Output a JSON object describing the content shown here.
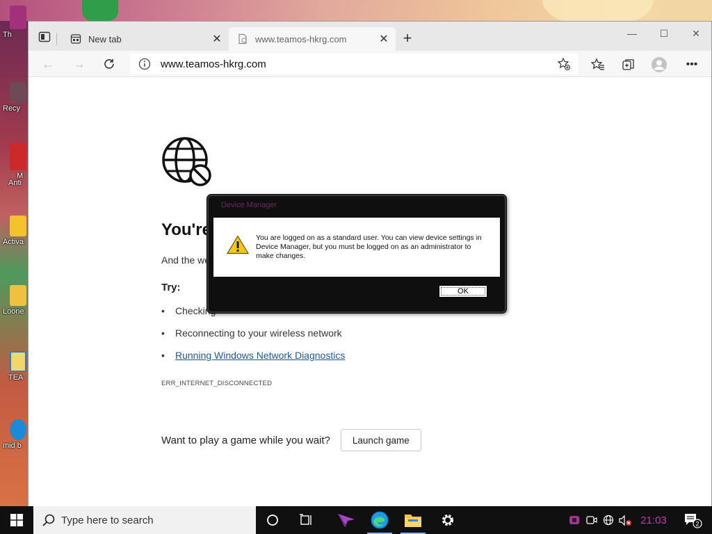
{
  "desktop": {
    "icons": [
      {
        "label": "Th",
        "color": "#a3307a"
      },
      {
        "label": "Recy",
        "color": "#6d6d6d"
      },
      {
        "label": "M",
        "color": "#cc2a2a"
      },
      {
        "label": "Anti",
        "color": "#cc2a2a"
      },
      {
        "label": "Activa",
        "color": "#f2c32d"
      },
      {
        "label": "Loone",
        "color": "#f0c040"
      },
      {
        "label": "TEA",
        "color": "#2b7bd6"
      },
      {
        "label": "mid b",
        "color": "#1e8ad6"
      }
    ]
  },
  "browser": {
    "tabs": [
      {
        "label": "New tab",
        "close": "✕"
      },
      {
        "label": "www.teamos-hkrg.com",
        "close": "✕"
      }
    ],
    "new_tab": "+",
    "window_controls": {
      "minimize": "—",
      "maximize": "☐",
      "close": "✕"
    },
    "toolbar": {
      "back": "←",
      "forward": "→",
      "url": "www.teamos-hkrg.com"
    },
    "page": {
      "heading": "You're",
      "subtext": "And the we",
      "try_label": "Try:",
      "tips": [
        {
          "bullet": "•",
          "text": "Checking"
        },
        {
          "bullet": "•",
          "text": "Reconnecting to your wireless network"
        },
        {
          "bullet": "•",
          "text": "Running Windows Network Diagnostics"
        }
      ],
      "error_code": "ERR_INTERNET_DISCONNECTED",
      "game_prompt": "Want to play a game while you wait?",
      "game_button": "Launch game"
    }
  },
  "dialog": {
    "title": "Device Manager",
    "message": "You are logged on as a standard user. You can view device settings in Device Manager, but you must be logged on as an administrator to make changes.",
    "ok_label": "OK"
  },
  "taskbar": {
    "search_placeholder": "Type here to search",
    "clock": "21:03",
    "notification_count": "2",
    "colors": {
      "accent": "#8ab4f8",
      "clock": "#c23bb0"
    }
  }
}
